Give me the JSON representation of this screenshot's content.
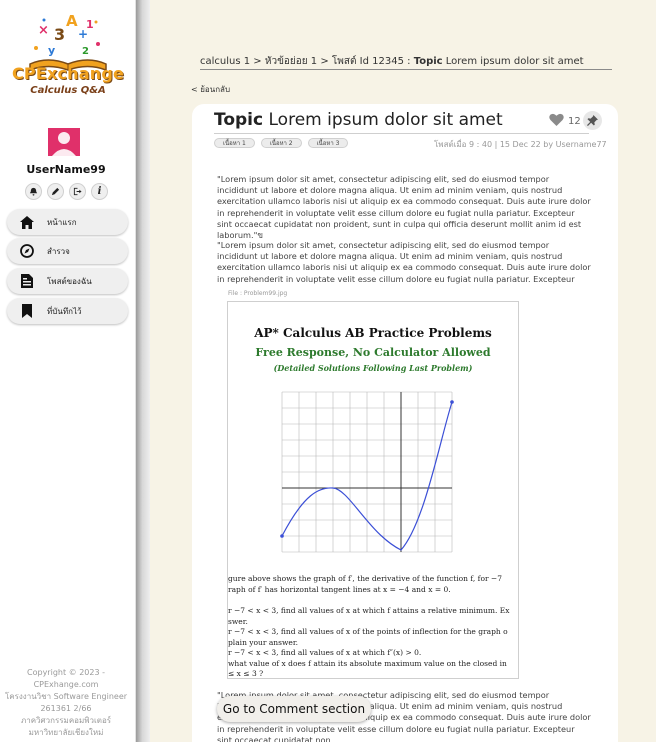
{
  "sidebar": {
    "logo_text": "CPExchange",
    "logo_sub": "Calculus Q&A",
    "username": "UserName99",
    "user_icons": [
      "bell-icon",
      "pencil-icon",
      "logout-icon",
      "info-icon"
    ],
    "nav": [
      {
        "label": "หน้าแรก",
        "icon": "home-icon"
      },
      {
        "label": "สำรวจ",
        "icon": "compass-icon"
      },
      {
        "label": "โพสต์ของฉัน",
        "icon": "document-icon"
      },
      {
        "label": "ที่บันทึกไว้",
        "icon": "bookmark-icon"
      }
    ],
    "footer": {
      "line1": "Copyright © 2023 -",
      "line2": "CPExhange.com",
      "line3": "โครงงานวิชา Software Engineer",
      "line4": "261361 2/66",
      "line5": "ภาควิศวกรรมคอมพิวเตอร์",
      "line6": "มหาวิทยาลัยเชียงใหม่"
    }
  },
  "breadcrumb": {
    "part1": "calculus 1 >",
    "part2": "หัวข้อย่อย 1",
    "part3": "> โพสต์ Id 12345 :",
    "topic_word": "Topic",
    "topic_rest": "Lorem ipsum dolor sit amet"
  },
  "back_link": "< ย้อนกลับ",
  "post": {
    "title_bold": "Topic",
    "title_rest": "Lorem ipsum dolor sit amet",
    "likes": "12",
    "tags": [
      "เนื้อหา 1",
      "เนื้อหา 2",
      "เนื้อหา 3"
    ],
    "meta": "โพสต์เมื่อ 9 : 40 | 15 Dec 22 by Username77",
    "para1": "\"Lorem ipsum dolor sit amet, consectetur adipiscing elit, sed do eiusmod tempor incididunt ut labore et dolore magna aliqua. Ut enim ad minim veniam, quis nostrud exercitation ullamco laboris nisi ut aliquip ex ea commodo consequat. Duis aute irure dolor in reprehenderit in voluptate velit esse cillum dolore eu fugiat nulla pariatur. Excepteur sint occaecat cupidatat non proident, sunt in culpa qui officia deserunt mollit anim id est laborum.\"ข",
    "para2": "\"Lorem ipsum dolor sit amet, consectetur adipiscing elit, sed do eiusmod tempor incididunt ut labore et dolore magna aliqua. Ut enim ad minim veniam, quis nostrud exercitation ullamco laboris nisi ut aliquip ex ea commodo consequat. Duis aute irure dolor in reprehenderit in voluptate velit esse cillum dolore eu fugiat nulla pariatur. Excepteur sint occaecat cupidatat non",
    "file_label": "File : Problem99.jpg",
    "para3": "\"Lorem ipsum dolor sit amet, consectetur adipiscing elit, sed do eiusmod tempor incididunt ut labore et dolore magna aliqua. Ut enim ad minim veniam, quis nostrud exercitation ullamco laboris nisi ut aliquip ex ea commodo consequat. Duis aute irure dolor in reprehenderit in voluptate velit esse cillum dolore eu fugiat nulla pariatur. Excepteur sint occaecat cupidatat non"
  },
  "attachment": {
    "heading1": "AP* Calculus AB Practice Problems",
    "heading2": "Free Response, No Calculator Allowed",
    "heading3": "(Detailed Solutions Following Last Problem)",
    "lines": [
      "gure above shows the graph of f′, the derivative of the function f, for −7",
      "raph of f′ has horizontal tangent lines at x = −4 and x = 0.",
      "r −7 < x < 3, find all values of x at which f attains a relative minimum. Ex",
      "swer.",
      "r −7 < x < 3, find all values of x of the points of inflection for the graph o",
      "plain your answer.",
      "r −7 < x < 3, find all values of x at which f″(x) > 0.",
      " what value of x does f attain its absolute maximum value on the closed in",
      "≤ x ≤ 3 ?"
    ]
  },
  "comment_button": "Go to Comment section",
  "colors": {
    "accent_orange": "#f1a21f",
    "avatar_pink": "#e0306a",
    "page_bg": "#f7f3e6",
    "graph_blue": "#3b4fd6"
  }
}
